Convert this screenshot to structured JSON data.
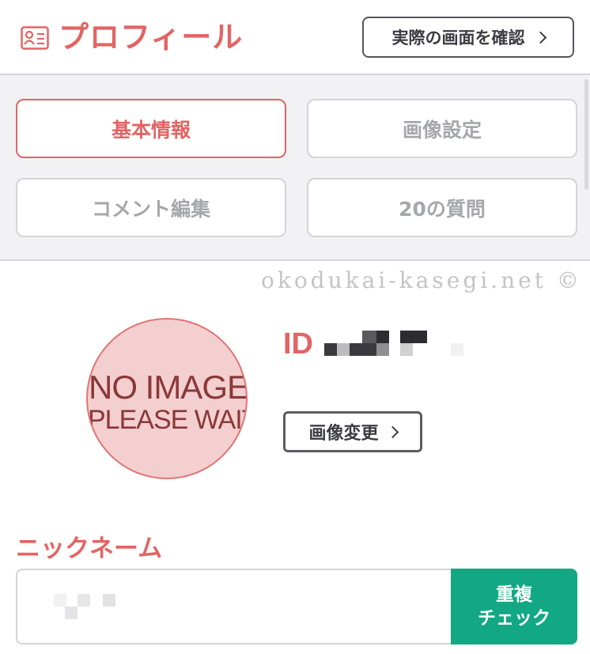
{
  "header": {
    "title": "プロフィール",
    "preview_button": "実際の画面を確認"
  },
  "tabs": [
    {
      "label": "基本情報",
      "active": true
    },
    {
      "label": "画像設定",
      "active": false
    },
    {
      "label": "コメント編集",
      "active": false
    },
    {
      "label": "20の質問",
      "active": false
    }
  ],
  "watermark": "okodukai-kasegi.net ©",
  "profile": {
    "avatar_line1": "NO IMAGE",
    "avatar_line2": "PLEASE WAIT",
    "id_label": "ID",
    "change_image_button": "画像変更"
  },
  "nickname": {
    "label": "ニックネーム",
    "check_button_line1": "重複",
    "check_button_line2": "チェック"
  },
  "colors": {
    "accent": "#e36464",
    "check_button": "#11a883",
    "border": "#d4d4d8"
  }
}
